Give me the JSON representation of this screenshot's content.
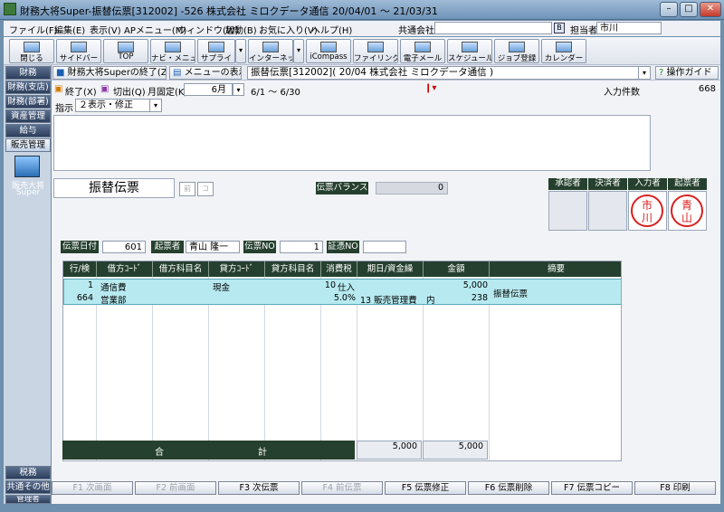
{
  "window": {
    "title": "財務大将Super-振替伝票[312002] -526 株式会社 ミロクデータ通信 20/04/01 ～ 21/03/31",
    "minimize": "–",
    "maximize": "□",
    "close": "✕"
  },
  "menu": {
    "items": [
      "ファイル(F)",
      "編集(E)",
      "表示(V)",
      "APメニュー(M)",
      "ウィンドウ(W)",
      "起動(B)",
      "お気に入り(V)",
      "ヘルプ(H)"
    ],
    "company_label": "共通会社",
    "person_label": "担当者",
    "person_value": "市川"
  },
  "toolbar": {
    "items": [
      "閉じる",
      "サイドバー",
      "TOP",
      "ナビ・メニュー",
      "サプライ",
      "インターネット",
      "iCompass",
      "ファイリング",
      "電子メール",
      "スケジュール",
      "ジョブ登録",
      "カレンダー"
    ]
  },
  "nav": {
    "top": [
      "財務",
      "財務(支店)",
      "財務(部署)",
      "資産管理",
      "給与",
      "販売管理"
    ],
    "app_label_1": "販売大将",
    "app_label_2": "Super",
    "bottom": [
      "税務",
      "共通その他",
      "管理者"
    ]
  },
  "tabbar": {
    "exit": "財務大将Superの終了(Z)",
    "menu": "メニューの表示",
    "doc_title": "振替伝票[312002]( 20/04 株式会社 ミロクデータ通信 )",
    "guide": "操作ガイド"
  },
  "subbar": {
    "end": "終了(X)",
    "cut": "切出(Q)",
    "month_label": "月固定(K)",
    "month_value": "6月",
    "range": "6/1 ～ 6/30",
    "count_label": "入力件数",
    "count_value": "668"
  },
  "instruction": {
    "label": "指示",
    "value": "２表示・修正"
  },
  "voucher": {
    "title": "振替伝票",
    "btn1": "前",
    "btn2": "コ",
    "balance_label": "伝票バランス",
    "balance_value": "0"
  },
  "approvals": {
    "headers": [
      "承認者",
      "決済者",
      "入力者",
      "起票者"
    ],
    "stamp_input": [
      "市",
      "川"
    ],
    "stamp_draft": [
      "青",
      "山"
    ]
  },
  "header_fields": {
    "date_label": "伝票日付",
    "date_value": "601",
    "drafter_label": "起票者",
    "drafter_value": "青山 隆一",
    "no_label": "伝票NO",
    "no_value": "1",
    "evidence_label": "証憑NO",
    "evidence_value": ""
  },
  "table": {
    "headers": [
      "行/検",
      "借方ｺｰﾄﾞ",
      "借方科目名",
      "貸方ｺｰﾄﾞ",
      "貸方科目名",
      "消費税",
      "期日/資金繰",
      "金額",
      "摘要"
    ],
    "row": {
      "line": "1",
      "line_sub": "664",
      "debit_code": "通信費",
      "debit_code_sub": "営業部",
      "credit_code": "現金",
      "tax": "10",
      "tax_sub": "5.0%",
      "tax_type": "仕入",
      "fund": "13 販売管理費",
      "fund_suffix": "内",
      "amount": "5,000",
      "amount_tax": "238",
      "memo": "振替伝票"
    },
    "total_label_1": "合",
    "total_label_2": "計",
    "total_debit": "5,000",
    "total_credit": "5,000"
  },
  "fkeys": [
    {
      "label": "F1 次画面",
      "enabled": false
    },
    {
      "label": "F2 前画面",
      "enabled": false
    },
    {
      "label": "F3 次伝票",
      "enabled": true
    },
    {
      "label": "F4 前伝票",
      "enabled": false
    },
    {
      "label": "F5 伝票修正",
      "enabled": true
    },
    {
      "label": "F6 伝票削除",
      "enabled": true
    },
    {
      "label": "F7 伝票コピー",
      "enabled": true
    },
    {
      "label": "F8 印刷",
      "enabled": true
    }
  ]
}
